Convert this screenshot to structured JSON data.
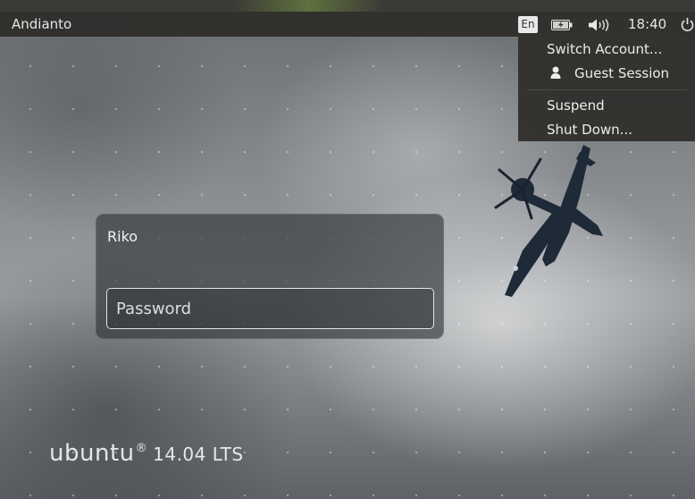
{
  "topbar": {
    "hostname": "Andianto",
    "keyboard_layout": "En",
    "clock": "18:40",
    "indicators": [
      "battery-icon",
      "volume-icon",
      "power-icon"
    ]
  },
  "session_menu": {
    "switch_account": "Switch Account...",
    "guest_session": "Guest Session",
    "suspend": "Suspend",
    "shut_down": "Shut Down..."
  },
  "login": {
    "username": "Riko",
    "password_placeholder": "Password"
  },
  "branding": {
    "name": "ubuntu",
    "registered": "®",
    "version": "14.04 LTS"
  },
  "colors": {
    "panel": "#2d2b28",
    "menu": "#302e2b",
    "text": "#e6e6e6"
  }
}
